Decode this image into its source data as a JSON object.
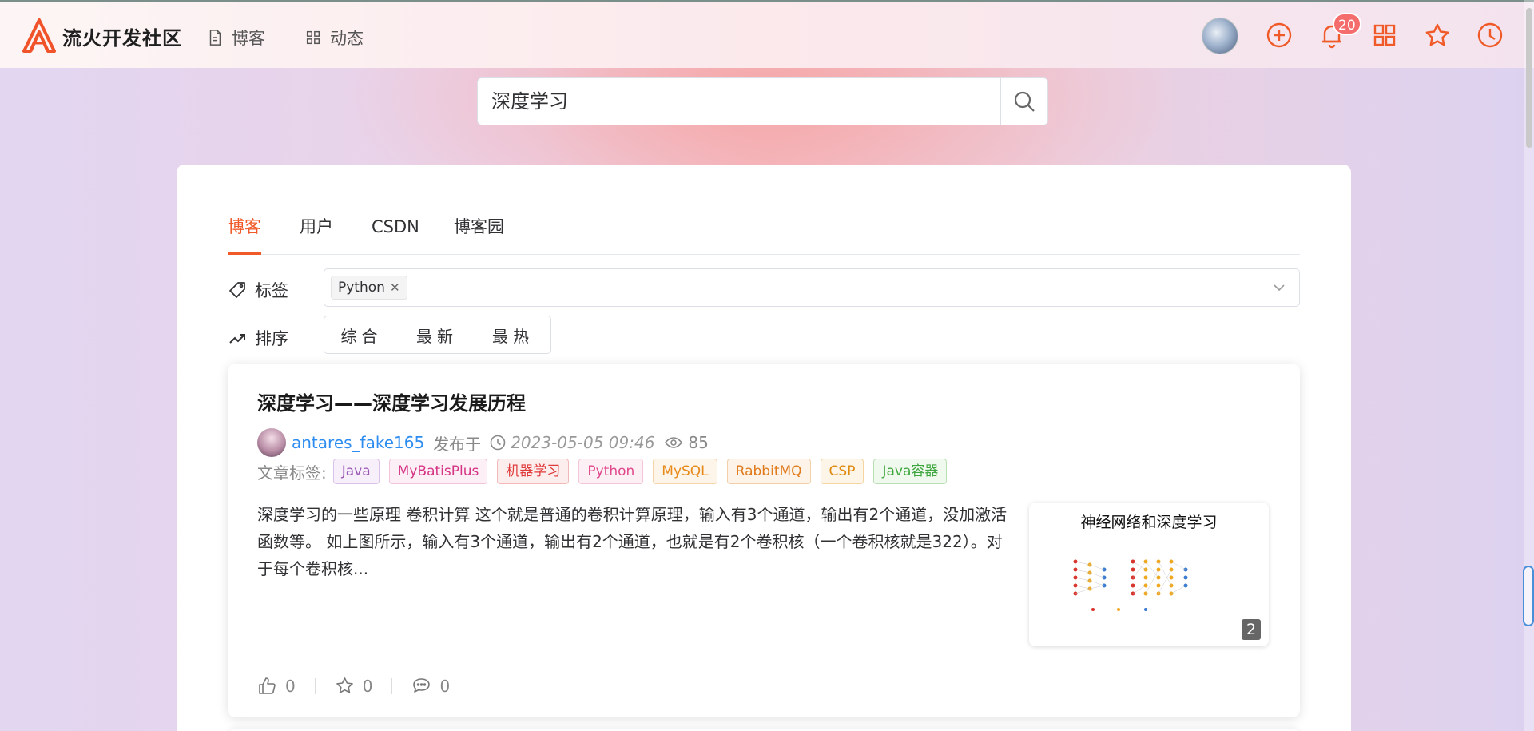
{
  "header": {
    "app_name": "流火开发社区",
    "nav": [
      {
        "label": "博客",
        "icon": "document-icon"
      },
      {
        "label": "动态",
        "icon": "grid-icon"
      }
    ],
    "notification_count": "20",
    "accent_color": "#f05a28"
  },
  "search": {
    "value": "深度学习"
  },
  "tabs": [
    {
      "label": "博客",
      "active": true
    },
    {
      "label": "用户",
      "active": false
    },
    {
      "label": "CSDN",
      "active": false
    },
    {
      "label": "博客园",
      "active": false
    }
  ],
  "filters": {
    "tag_label": "标签",
    "selected_tag": "Python",
    "sort_label": "排序",
    "sort_options": [
      "综合",
      "最新",
      "最热"
    ]
  },
  "article": {
    "title": "深度学习——深度学习发展历程",
    "author": "antares_fake165",
    "published_label": "发布于",
    "date": "2023-05-05 09:46",
    "views": "85",
    "tags_label": "文章标签:",
    "tags": [
      {
        "name": "Java",
        "color": "#9b59b6",
        "bg": "#f7f0fb"
      },
      {
        "name": "MyBatisPlus",
        "color": "#d63384",
        "bg": "#fcf0f6"
      },
      {
        "name": "机器学习",
        "color": "#e03b3b",
        "bg": "#fdeeee"
      },
      {
        "name": "Python",
        "color": "#e0488c",
        "bg": "#fdf0f5"
      },
      {
        "name": "MySQL",
        "color": "#e88a1a",
        "bg": "#fdf5ea"
      },
      {
        "name": "RabbitMQ",
        "color": "#e07a1a",
        "bg": "#fdf3e8"
      },
      {
        "name": "CSP",
        "color": "#e08a10",
        "bg": "#fdf6e8"
      },
      {
        "name": "Java容器",
        "color": "#3ea63e",
        "bg": "#f0f9ee"
      }
    ],
    "excerpt": "深度学习的一些原理 卷积计算 这个就是普通的卷积计算原理，输入有3个通道，输出有2个通道，没加激活函数等。 如上图所示，输入有3个通道，输出有2个通道，也就是有2个卷积核（一个卷积核就是322）。对于每个卷积核...",
    "thumbnail_title": "神经网络和深度学习",
    "thumbnail_count": "2",
    "likes": "0",
    "favorites": "0",
    "comments": "0"
  }
}
